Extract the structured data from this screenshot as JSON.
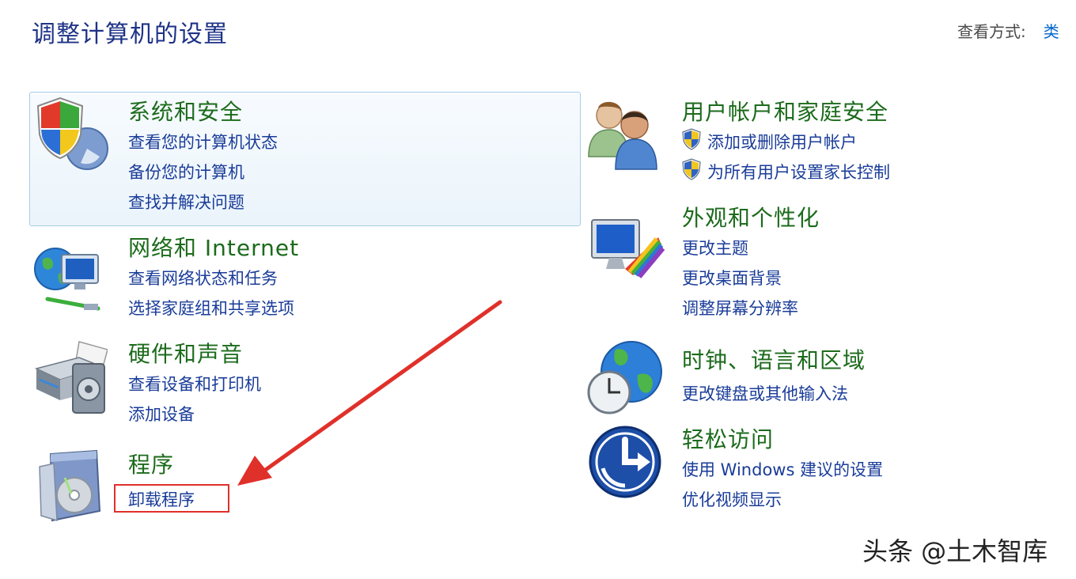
{
  "page": {
    "title": "调整计算机的设置"
  },
  "view_by": {
    "label": "查看方式:",
    "value": "类"
  },
  "categories": {
    "system_security": {
      "title": "系统和安全",
      "links": [
        "查看您的计算机状态",
        "备份您的计算机",
        "查找并解决问题"
      ],
      "icon": "shield-icon"
    },
    "network": {
      "title": "网络和 Internet",
      "links": [
        "查看网络状态和任务",
        "选择家庭组和共享选项"
      ],
      "icon": "network-icon"
    },
    "hardware": {
      "title": "硬件和声音",
      "links": [
        "查看设备和打印机",
        "添加设备"
      ],
      "icon": "printer-icon"
    },
    "programs": {
      "title": "程序",
      "links": [
        "卸载程序"
      ],
      "icon": "programs-icon"
    },
    "user_accounts": {
      "title": "用户帐户和家庭安全",
      "links": [
        "添加或删除用户帐户",
        "为所有用户设置家长控制"
      ],
      "icon": "users-icon"
    },
    "appearance": {
      "title": "外观和个性化",
      "links": [
        "更改主题",
        "更改桌面背景",
        "调整屏幕分辨率"
      ],
      "icon": "monitor-palette-icon"
    },
    "clock_region": {
      "title": "时钟、语言和区域",
      "links": [
        "更改键盘或其他输入法"
      ],
      "icon": "globe-clock-icon"
    },
    "ease_access": {
      "title": "轻松访问",
      "links": [
        "使用 Windows 建议的设置",
        "优化视频显示"
      ],
      "icon": "ease-of-access-icon"
    }
  },
  "watermark": "头条 @土木智库",
  "colors": {
    "title": "#1e3287",
    "category": "#1c6b1c",
    "link": "#1a3c99",
    "annotation": "#e0302a"
  }
}
